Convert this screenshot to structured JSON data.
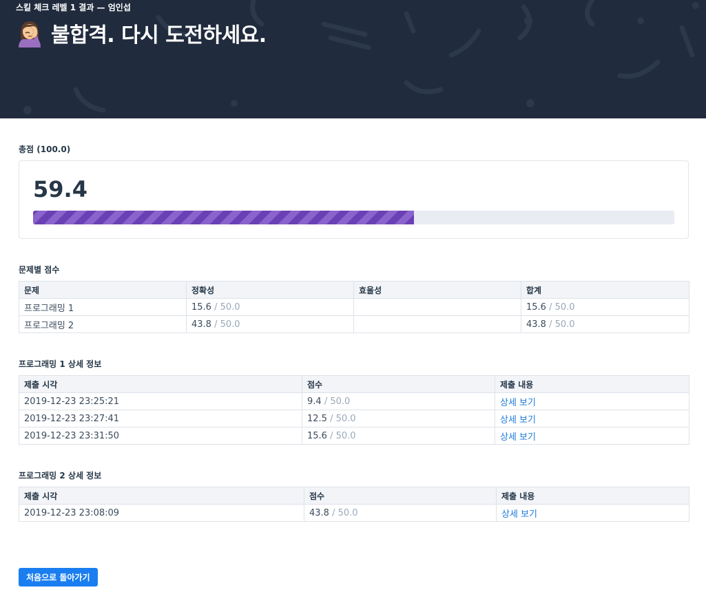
{
  "hero": {
    "subtitle": "스킬 체크 레벨 1 결과 — 엄인섭",
    "title": "불합격. 다시 도전하세요.",
    "emoji_icon": "face-palm-emoji",
    "background": "#202b3d"
  },
  "score": {
    "label": "총점 (100.0)",
    "value": "59.4",
    "progress_fraction": 0.594,
    "bar_color": "#6b40b5"
  },
  "problems": {
    "title": "문제별 점수",
    "headers": [
      "문제",
      "정확성",
      "효율성",
      "합계"
    ],
    "rows": [
      {
        "name": "프로그래밍 1",
        "accuracy": "15.6",
        "accuracy_max": " / 50.0",
        "efficiency": "",
        "total": "15.6",
        "total_max": " / 50.0"
      },
      {
        "name": "프로그래밍 2",
        "accuracy": "43.8",
        "accuracy_max": " / 50.0",
        "efficiency": "",
        "total": "43.8",
        "total_max": " / 50.0"
      }
    ]
  },
  "detail1": {
    "title": "프로그래밍 1 상세 정보",
    "headers": [
      "제출 시각",
      "점수",
      "제출 내용"
    ],
    "rows": [
      {
        "time": "2019-12-23 23:25:21",
        "score": "9.4",
        "max": " / 50.0",
        "link": "상세 보기"
      },
      {
        "time": "2019-12-23 23:27:41",
        "score": "12.5",
        "max": " / 50.0",
        "link": "상세 보기"
      },
      {
        "time": "2019-12-23 23:31:50",
        "score": "15.6",
        "max": " / 50.0",
        "link": "상세 보기"
      }
    ]
  },
  "detail2": {
    "title": "프로그래밍 2 상세 정보",
    "headers": [
      "제출 시각",
      "점수",
      "제출 내용"
    ],
    "rows": [
      {
        "time": "2019-12-23 23:08:09",
        "score": "43.8",
        "max": " / 50.0",
        "link": "상세 보기"
      }
    ]
  },
  "back_button": {
    "label": "처음으로 돌아가기",
    "color": "#1a7ef0"
  }
}
